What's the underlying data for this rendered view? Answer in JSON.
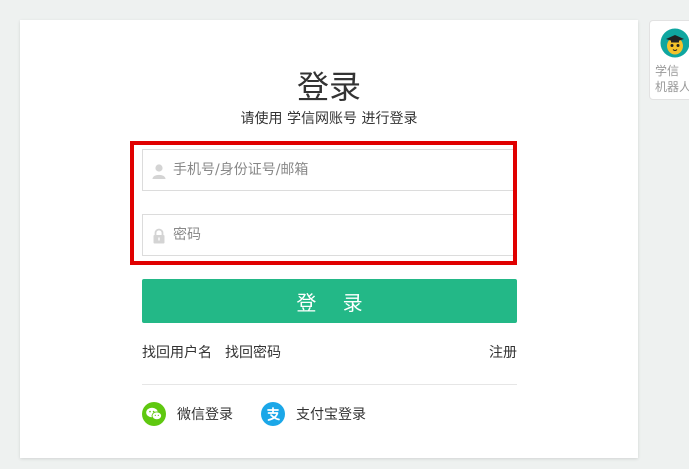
{
  "login": {
    "title": "登录",
    "subtitle": "请使用 学信网账号 进行登录",
    "username_placeholder": "手机号/身份证号/邮箱",
    "password_placeholder": "密码",
    "submit_label": "登 录"
  },
  "links": {
    "find_username": "找回用户名",
    "find_password": "找回密码",
    "register": "注册"
  },
  "third_party": {
    "wechat_label": "微信登录",
    "alipay_label": "支付宝登录"
  },
  "robot": {
    "line1": "学信",
    "line2": "机器人"
  },
  "colors": {
    "primary": "#23b887",
    "highlight": "#e00000",
    "wechat": "#5fc810",
    "alipay": "#1ba7e8"
  },
  "icons": {
    "username": "user-icon",
    "password": "lock-icon",
    "wechat": "wechat-icon",
    "alipay": "alipay-icon",
    "robot": "robot-avatar-icon"
  }
}
